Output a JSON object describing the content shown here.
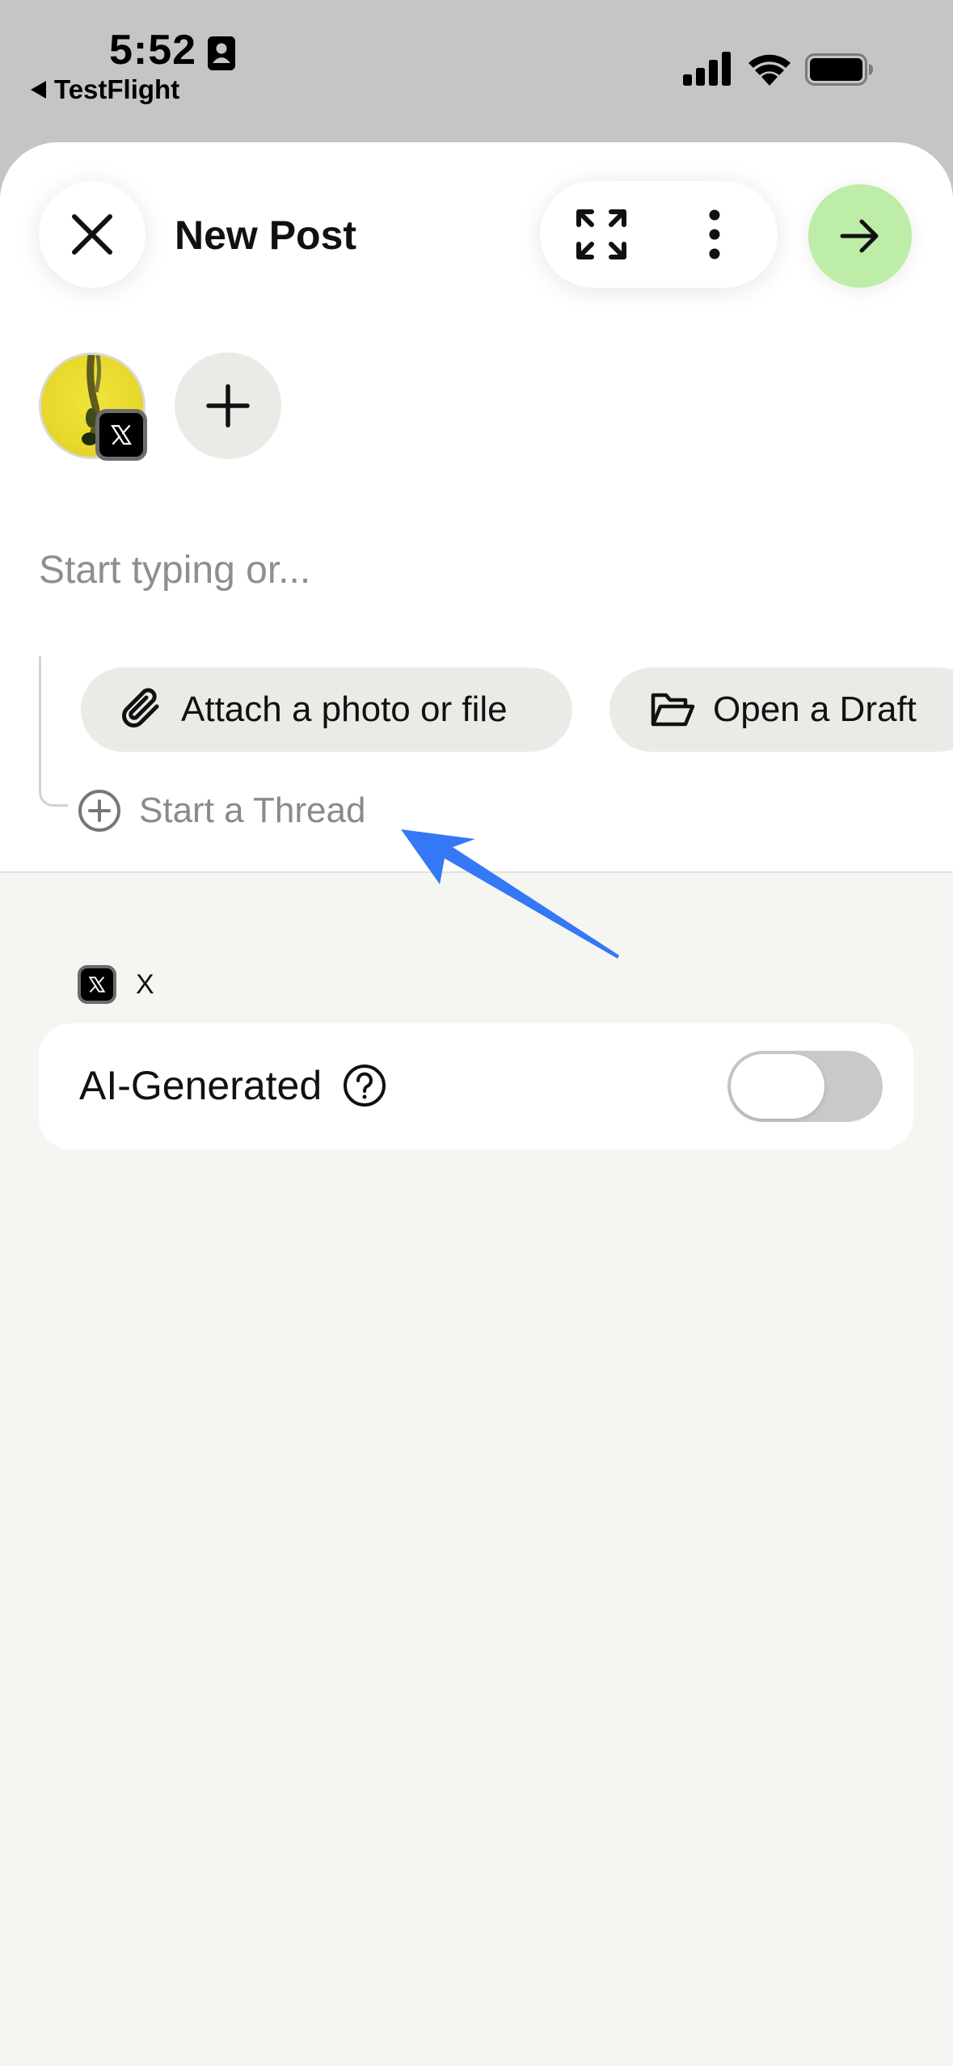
{
  "status_bar": {
    "time": "5:52",
    "back_app": "TestFlight",
    "icons": [
      "contact-card-icon",
      "cellular-signal-icon",
      "wifi-icon",
      "battery-icon"
    ]
  },
  "header": {
    "title": "New Post",
    "close_icon": "close-icon",
    "expand_icon": "expand-icon",
    "more_icon": "more-vertical-icon",
    "send_icon": "arrow-right-icon"
  },
  "accounts": {
    "selected_platform_icon": "x-logo-icon",
    "add_icon": "plus-icon"
  },
  "composer": {
    "placeholder": "Start typing or...",
    "value": "",
    "attach_label": "Attach a photo or file",
    "open_draft_label": "Open a Draft",
    "start_thread_label": "Start a Thread"
  },
  "settings": {
    "platform_label": "X",
    "ai_generated_label": "AI-Generated",
    "ai_generated_on": false
  },
  "colors": {
    "send_button": "#bdeda6",
    "sheet_background": "#f5f5f2",
    "chip_background": "#ebeae6",
    "annotation_arrow": "#3478f6"
  }
}
